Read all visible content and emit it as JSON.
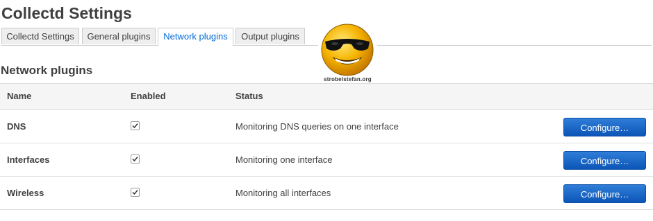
{
  "page": {
    "title": "Collectd Settings"
  },
  "tabs": [
    {
      "label": "Collectd Settings",
      "active": false
    },
    {
      "label": "General plugins",
      "active": false
    },
    {
      "label": "Network plugins",
      "active": true
    },
    {
      "label": "Output plugins",
      "active": false
    }
  ],
  "section": {
    "title": "Network plugins"
  },
  "logo": {
    "caption": "strobelstefan.org",
    "icon": "sunglasses-smiley-icon"
  },
  "table": {
    "headers": {
      "name": "Name",
      "enabled": "Enabled",
      "status": "Status"
    },
    "rows": [
      {
        "name": "DNS",
        "enabled": true,
        "status": "Monitoring DNS queries on one interface",
        "action": "Configure…"
      },
      {
        "name": "Interfaces",
        "enabled": true,
        "status": "Monitoring one interface",
        "action": "Configure…"
      },
      {
        "name": "Wireless",
        "enabled": true,
        "status": "Monitoring all interfaces",
        "action": "Configure…"
      }
    ]
  },
  "colors": {
    "active_tab_text": "#0069d6",
    "button_bg": "#1562c4",
    "heading_text": "#404040"
  }
}
